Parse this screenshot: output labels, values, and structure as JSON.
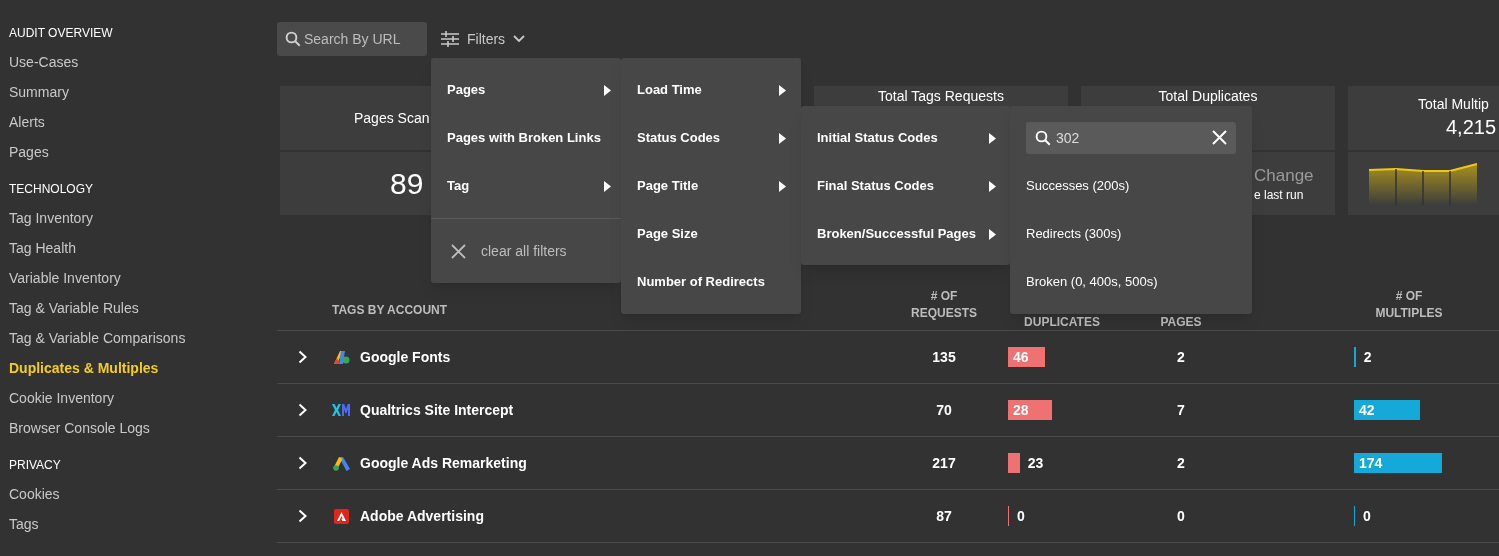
{
  "sidebar": {
    "sections": [
      {
        "heading": "AUDIT OVERVIEW",
        "items": [
          {
            "label": "Use-Cases",
            "selected": false
          },
          {
            "label": "Summary",
            "selected": false
          },
          {
            "label": "Alerts",
            "selected": false
          },
          {
            "label": "Pages",
            "selected": false
          }
        ]
      },
      {
        "heading": "TECHNOLOGY",
        "items": [
          {
            "label": "Tag Inventory",
            "selected": false
          },
          {
            "label": "Tag Health",
            "selected": false
          },
          {
            "label": "Variable Inventory",
            "selected": false
          },
          {
            "label": "Tag & Variable Rules",
            "selected": false
          },
          {
            "label": "Tag & Variable Comparisons",
            "selected": false
          },
          {
            "label": "Duplicates & Multiples",
            "selected": true
          },
          {
            "label": "Cookie Inventory",
            "selected": false
          },
          {
            "label": "Browser Console Logs",
            "selected": false
          }
        ]
      },
      {
        "heading": "PRIVACY",
        "items": [
          {
            "label": "Cookies",
            "selected": false
          },
          {
            "label": "Tags",
            "selected": false
          }
        ]
      }
    ]
  },
  "toolbar": {
    "search": {
      "placeholder": "Search By URL"
    },
    "filters_label": "Filters"
  },
  "stat_cards": [
    {
      "kind": "number",
      "title": "Pages Scan",
      "value": "89"
    },
    {
      "kind": "hidden"
    },
    {
      "kind": "title",
      "title": "Total Tags Requests"
    },
    {
      "kind": "change",
      "title": "Total Duplicates",
      "change": "Change",
      "note": "e last run"
    },
    {
      "kind": "sparkline",
      "title": "Total Multip",
      "value": "4,215"
    }
  ],
  "table": {
    "columns": [
      "TAGS BY ACCOUNT",
      "# OF REQUESTS",
      "DUPLICATES",
      "PAGES",
      "# OF MULTIPLES"
    ],
    "rows": [
      {
        "kind": "fonts",
        "name": "Google Fonts",
        "requests": "135",
        "duplicates": "46",
        "pages": "2",
        "multiples": "2"
      },
      {
        "kind": "xm",
        "name": "Qualtrics Site Intercept",
        "requests": "70",
        "duplicates": "28",
        "pages": "7",
        "multiples": "42"
      },
      {
        "kind": "ads",
        "name": "Google Ads Remarketing",
        "requests": "217",
        "duplicates": "23",
        "pages": "2",
        "multiples": "174"
      },
      {
        "kind": "adobe",
        "name": "Adobe Advertising",
        "requests": "87",
        "duplicates": "0",
        "pages": "0",
        "multiples": "0"
      }
    ]
  },
  "menus": [
    {
      "items": [
        {
          "label": "Pages",
          "submenu": true
        },
        {
          "label": "Pages with Broken Links",
          "submenu": false
        },
        {
          "label": "Tag",
          "submenu": true
        }
      ],
      "clear_label": "clear all filters"
    },
    {
      "items": [
        {
          "label": "Load Time",
          "submenu": true
        },
        {
          "label": "Status Codes",
          "submenu": true
        },
        {
          "label": "Page Title",
          "submenu": true
        },
        {
          "label": "Page Size",
          "submenu": false
        },
        {
          "label": "Number of Redirects",
          "submenu": false
        }
      ]
    },
    {
      "items": [
        {
          "label": "Initial Status Codes",
          "submenu": true
        },
        {
          "label": "Final Status Codes",
          "submenu": true
        },
        {
          "label": "Broken/Successful Pages",
          "submenu": true
        }
      ]
    },
    {
      "search_value": "302",
      "items": [
        {
          "label": "Successes (200s)",
          "submenu": false
        },
        {
          "label": "Redirects (300s)",
          "submenu": false
        },
        {
          "label": "Broken (0, 400s, 500s)",
          "submenu": false
        }
      ]
    }
  ]
}
